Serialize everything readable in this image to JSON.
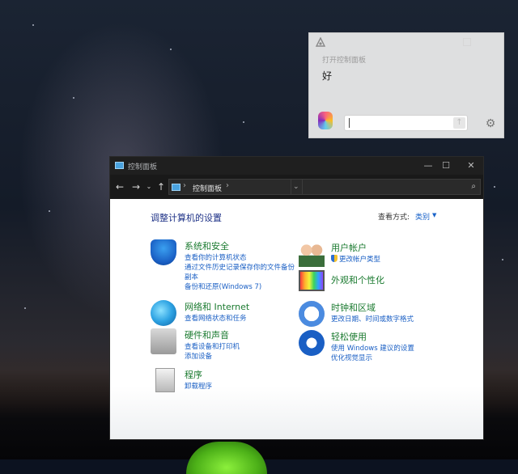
{
  "assistant": {
    "subtitle": "打开控制面板",
    "reply": "好",
    "input_placeholder": ""
  },
  "window": {
    "title": "控制面板",
    "controls": {
      "minimize": "—",
      "maximize": "☐",
      "close": "✕"
    },
    "address_crumb": "控制面板",
    "search_placeholder": ""
  },
  "content": {
    "heading": "调整计算机的设置",
    "view_by_label": "查看方式:",
    "view_by_value": "类别",
    "left": [
      {
        "title": "系统和安全",
        "links": [
          "查看你的计算机状态",
          "通过文件历史记录保存你的文件备份",
          "副本",
          "备份和还原(Windows 7)"
        ]
      },
      {
        "title": "网络和 Internet",
        "links": [
          "查看网络状态和任务"
        ]
      },
      {
        "title": "硬件和声音",
        "links": [
          "查看设备和打印机",
          "添加设备"
        ]
      },
      {
        "title": "程序",
        "links": [
          "卸载程序"
        ]
      }
    ],
    "right": [
      {
        "title": "用户帐户",
        "links": [
          "更改帐户类型"
        ]
      },
      {
        "title": "外观和个性化",
        "links": []
      },
      {
        "title": "时钟和区域",
        "links": [
          "更改日期、时间或数字格式"
        ]
      },
      {
        "title": "轻松使用",
        "links": [
          "使用 Windows 建议的设置",
          "优化视觉显示"
        ]
      }
    ]
  },
  "colors": {
    "heading": "#1e3287",
    "category_title": "#1a7a2f",
    "link": "#1a5fc4",
    "titlebar": "#1f1f1f"
  }
}
